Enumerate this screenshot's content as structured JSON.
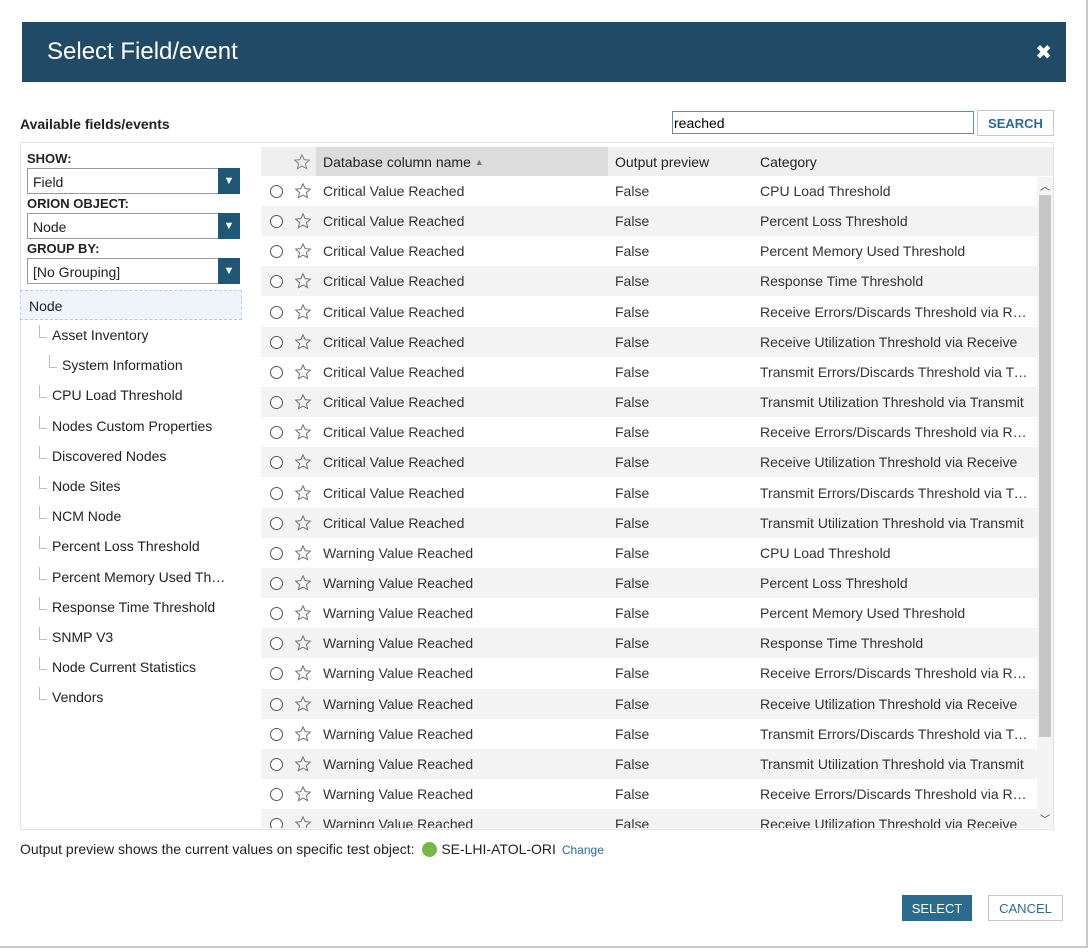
{
  "dialog": {
    "title": "Select Field/event",
    "close_glyph": "✖"
  },
  "available_label": "Available fields/events",
  "search": {
    "value": "reached",
    "button_label": "SEARCH"
  },
  "filters": {
    "show_label": "SHOW:",
    "show_value": "Field",
    "object_label": "ORION OBJECT:",
    "object_value": "Node",
    "group_label": "GROUP BY:",
    "group_value": "[No Grouping]"
  },
  "tree": {
    "root": "Node",
    "items": [
      "Asset Inventory",
      "System Information",
      "CPU Load Threshold",
      "Nodes Custom Properties",
      "Discovered Nodes",
      "Node Sites",
      "NCM Node",
      "Percent Loss Threshold",
      "Percent Memory Used Th…",
      "Response Time Threshold",
      "SNMP V3",
      "Node Current Statistics",
      "Vendors"
    ]
  },
  "grid": {
    "columns": {
      "name": "Database column name",
      "preview": "Output preview",
      "category": "Category"
    },
    "sort_indicator": "▲",
    "rows": [
      {
        "name": "Critical Value Reached",
        "preview": "False",
        "category": "CPU Load Threshold"
      },
      {
        "name": "Critical Value Reached",
        "preview": "False",
        "category": "Percent Loss Threshold"
      },
      {
        "name": "Critical Value Reached",
        "preview": "False",
        "category": "Percent Memory Used Threshold"
      },
      {
        "name": "Critical Value Reached",
        "preview": "False",
        "category": "Response Time Threshold"
      },
      {
        "name": "Critical Value Reached",
        "preview": "False",
        "category": "Receive Errors/Discards Threshold via Receive"
      },
      {
        "name": "Critical Value Reached",
        "preview": "False",
        "category": "Receive Utilization Threshold via Receive"
      },
      {
        "name": "Critical Value Reached",
        "preview": "False",
        "category": "Transmit Errors/Discards Threshold via Transmit"
      },
      {
        "name": "Critical Value Reached",
        "preview": "False",
        "category": "Transmit Utilization Threshold via Transmit"
      },
      {
        "name": "Critical Value Reached",
        "preview": "False",
        "category": "Receive Errors/Discards Threshold via Receive"
      },
      {
        "name": "Critical Value Reached",
        "preview": "False",
        "category": "Receive Utilization Threshold via Receive"
      },
      {
        "name": "Critical Value Reached",
        "preview": "False",
        "category": "Transmit Errors/Discards Threshold via Transmit"
      },
      {
        "name": "Critical Value Reached",
        "preview": "False",
        "category": "Transmit Utilization Threshold via Transmit"
      },
      {
        "name": "Warning Value Reached",
        "preview": "False",
        "category": "CPU Load Threshold"
      },
      {
        "name": "Warning Value Reached",
        "preview": "False",
        "category": "Percent Loss Threshold"
      },
      {
        "name": "Warning Value Reached",
        "preview": "False",
        "category": "Percent Memory Used Threshold"
      },
      {
        "name": "Warning Value Reached",
        "preview": "False",
        "category": "Response Time Threshold"
      },
      {
        "name": "Warning Value Reached",
        "preview": "False",
        "category": "Receive Errors/Discards Threshold via Receive"
      },
      {
        "name": "Warning Value Reached",
        "preview": "False",
        "category": "Receive Utilization Threshold via Receive"
      },
      {
        "name": "Warning Value Reached",
        "preview": "False",
        "category": "Transmit Errors/Discards Threshold via Transmit"
      },
      {
        "name": "Warning Value Reached",
        "preview": "False",
        "category": "Transmit Utilization Threshold via Transmit"
      },
      {
        "name": "Warning Value Reached",
        "preview": "False",
        "category": "Receive Errors/Discards Threshold via Receive"
      },
      {
        "name": "Warning Value Reached",
        "preview": "False",
        "category": "Receive Utilization Threshold via Receive"
      }
    ]
  },
  "footer": {
    "note": "Output preview shows the current values on specific test object:",
    "object_name": "SE-LHI-ATOL-ORI",
    "change_link": "Change",
    "status_color": "#77b845"
  },
  "buttons": {
    "select": "SELECT",
    "cancel": "CANCEL"
  },
  "colors": {
    "titlebar": "#204a66",
    "accent": "#2b6b8e",
    "dropdown_arrow": "#1f5776"
  }
}
